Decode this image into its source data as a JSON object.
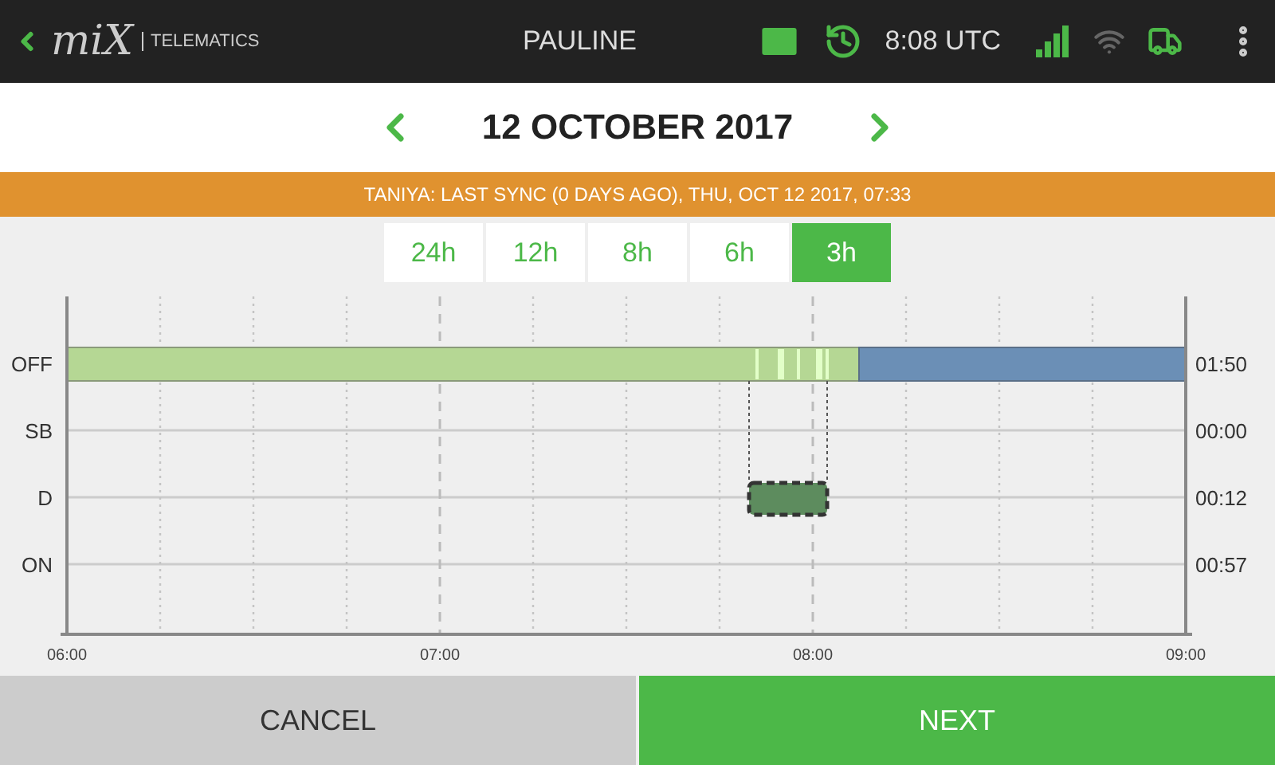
{
  "header": {
    "logo": "miX",
    "brand": "TELEMATICS",
    "driver": "PAULINE",
    "time": "8:08 UTC"
  },
  "date_nav": {
    "date": "12 OCTOBER 2017"
  },
  "sync_banner": "TANIYA: LAST SYNC (0 DAYS AGO), THU, OCT 12 2017, 07:33",
  "ranges": [
    {
      "label": "24h",
      "selected": false
    },
    {
      "label": "12h",
      "selected": false
    },
    {
      "label": "8h",
      "selected": false
    },
    {
      "label": "6h",
      "selected": false
    },
    {
      "label": "3h",
      "selected": true
    }
  ],
  "log_graph": {
    "rows": [
      {
        "label": "OFF",
        "total": "01:50"
      },
      {
        "label": "SB",
        "total": "00:00"
      },
      {
        "label": "D",
        "total": "00:12"
      },
      {
        "label": "ON",
        "total": "00:57"
      }
    ],
    "hours": [
      "06:00",
      "07:00",
      "08:00",
      "09:00"
    ]
  },
  "buttons": {
    "cancel": "CANCEL",
    "next": "NEXT"
  }
}
